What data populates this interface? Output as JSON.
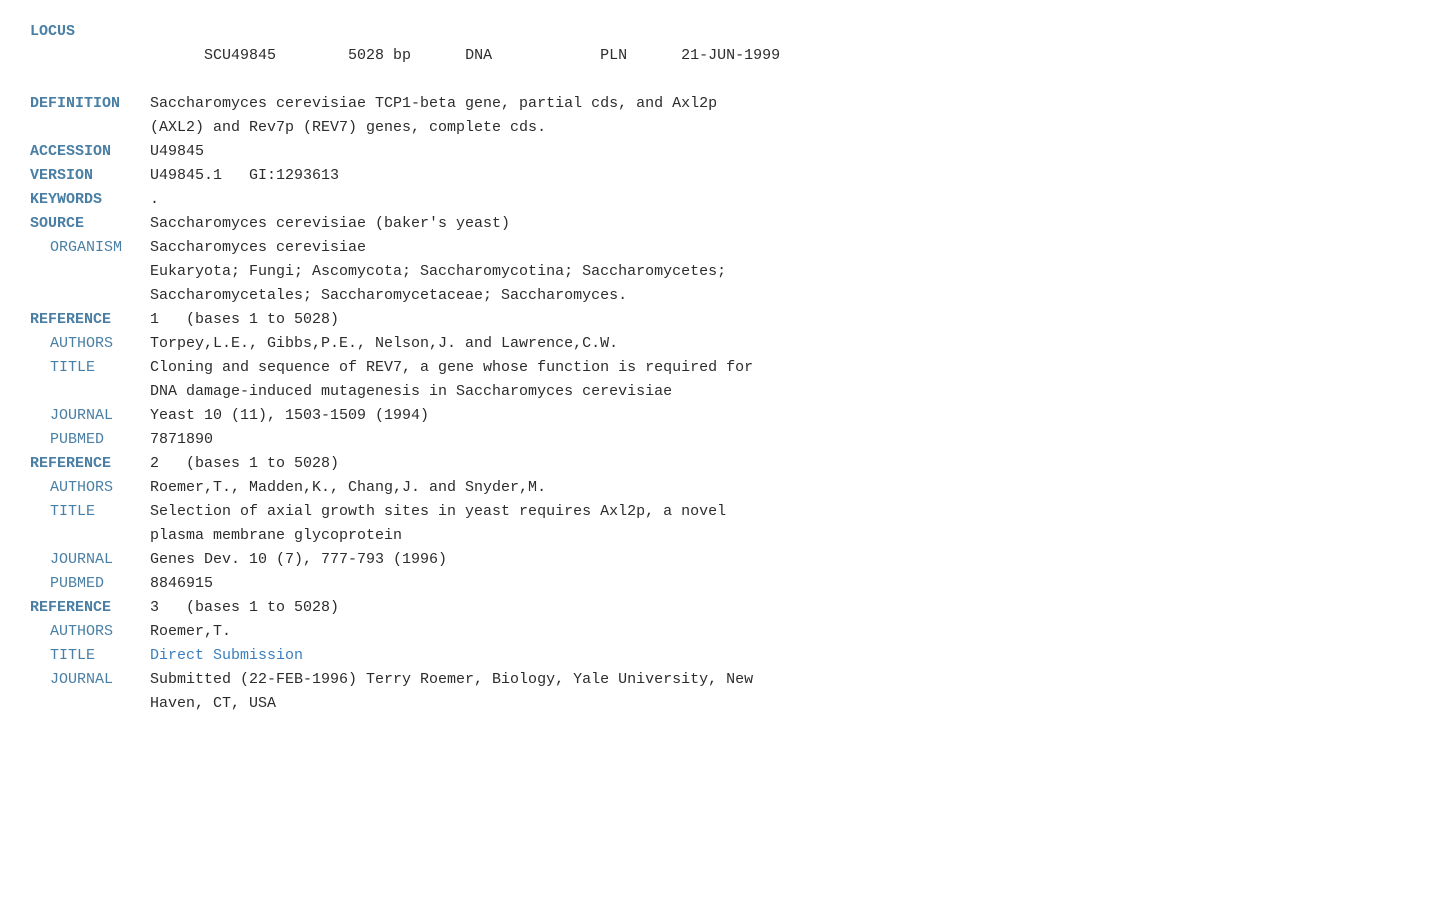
{
  "record": {
    "locus": {
      "label": "LOCUS",
      "accession": "SCU49845",
      "size": "5028 bp",
      "type": "DNA",
      "division": "PLN",
      "date": "21-JUN-1999"
    },
    "definition": {
      "label": "DEFINITION",
      "line1": "Saccharomyces cerevisiae TCP1-beta gene, partial cds, and Axl2p",
      "line2": "(AXL2) and Rev7p (REV7) genes, complete cds."
    },
    "accession": {
      "label": "ACCESSION",
      "value": "U49845"
    },
    "version": {
      "label": "VERSION",
      "value": "U49845.1   GI:1293613"
    },
    "keywords": {
      "label": "KEYWORDS",
      "value": "."
    },
    "source": {
      "label": "SOURCE",
      "value": "Saccharomyces cerevisiae (baker's yeast)"
    },
    "organism": {
      "label": "ORGANISM",
      "line1": "Saccharomyces cerevisiae",
      "line2": "Eukaryota; Fungi; Ascomycota; Saccharomycotina; Saccharomycetes;",
      "line3": "Saccharomycetales; Saccharomycetaceae; Saccharomyces."
    },
    "reference1": {
      "label": "REFERENCE",
      "value": "1   (bases 1 to 5028)"
    },
    "authors1": {
      "label": "AUTHORS",
      "value": "Torpey,L.E., Gibbs,P.E., Nelson,J. and Lawrence,C.W."
    },
    "title1": {
      "label": "TITLE",
      "line1": "Cloning and sequence of REV7, a gene whose function is required for",
      "line2": "DNA damage-induced mutagenesis in Saccharomyces cerevisiae"
    },
    "journal1": {
      "label": "JOURNAL",
      "value": "Yeast 10 (11), 1503-1509 (1994)"
    },
    "pubmed1": {
      "label": "PUBMED",
      "value": "7871890"
    },
    "reference2": {
      "label": "REFERENCE",
      "value": "2   (bases 1 to 5028)"
    },
    "authors2": {
      "label": "AUTHORS",
      "value": "Roemer,T., Madden,K., Chang,J. and Snyder,M."
    },
    "title2": {
      "label": "TITLE",
      "line1": "Selection of axial growth sites in yeast requires Axl2p, a novel",
      "line2": "plasma membrane glycoprotein"
    },
    "journal2": {
      "label": "JOURNAL",
      "value": "Genes Dev. 10 (7), 777-793 (1996)"
    },
    "pubmed2": {
      "label": "PUBMED",
      "value": "8846915"
    },
    "reference3": {
      "label": "REFERENCE",
      "value": "3   (bases 1 to 5028)"
    },
    "authors3": {
      "label": "AUTHORS",
      "value": "Roemer,T."
    },
    "title3": {
      "label": "TITLE",
      "value": "Direct Submission"
    },
    "journal3": {
      "label": "JOURNAL",
      "line1": "Submitted (22-FEB-1996) Terry Roemer, Biology, Yale University, New",
      "line2": "Haven, CT, USA"
    }
  }
}
